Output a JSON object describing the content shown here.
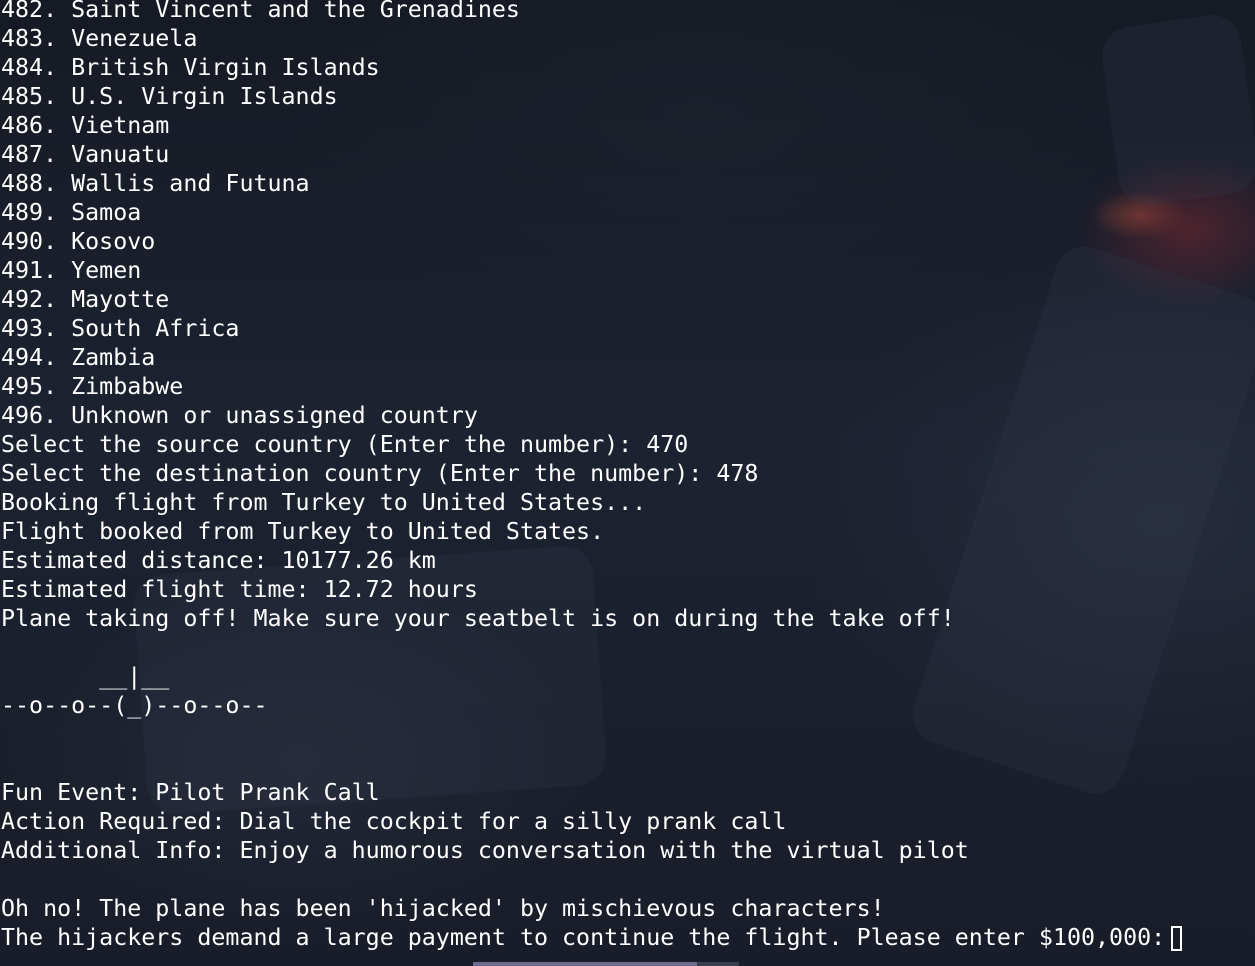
{
  "terminal": {
    "lines": [
      "482. Saint Vincent and the Grenadines",
      "483. Venezuela",
      "484. British Virgin Islands",
      "485. U.S. Virgin Islands",
      "486. Vietnam",
      "487. Vanuatu",
      "488. Wallis and Futuna",
      "489. Samoa",
      "490. Kosovo",
      "491. Yemen",
      "492. Mayotte",
      "493. South Africa",
      "494. Zambia",
      "495. Zimbabwe",
      "496. Unknown or unassigned country",
      "Select the source country (Enter the number): 470",
      "Select the destination country (Enter the number): 478",
      "Booking flight from Turkey to United States...",
      "Flight booked from Turkey to United States.",
      "Estimated distance: 10177.26 km",
      "Estimated flight time: 12.72 hours",
      "Plane taking off! Make sure your seatbelt is on during the take off!",
      "",
      "       __|__",
      "--o--o--(_)--o--o--",
      "",
      "",
      "Fun Event: Pilot Prank Call",
      "Action Required: Dial the cockpit for a silly prank call",
      "Additional Info: Enjoy a humorous conversation with the virtual pilot",
      "",
      "Oh no! The plane has been 'hijacked' by mischievous characters!"
    ],
    "prompt_line": "The hijackers demand a large payment to continue the flight. Please enter $100,000:"
  },
  "colors": {
    "text": "#ffffff",
    "background": "#1a1f2b",
    "scrollbar_thumb": "#6e6a8c"
  }
}
